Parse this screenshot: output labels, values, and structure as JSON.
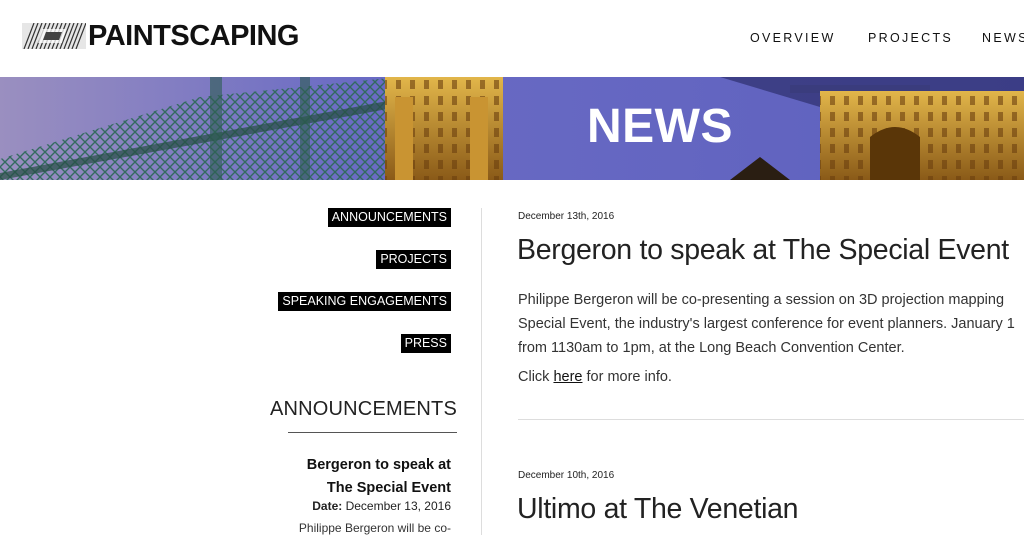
{
  "header": {
    "logo_text": "PAINTSCAPING",
    "nav": [
      "OVERVIEW",
      "PROJECTS",
      "NEWS"
    ]
  },
  "banner": {
    "title": "NEWS"
  },
  "sidebar": {
    "categories": [
      "ANNOUNCEMENTS",
      "PROJECTS",
      "SPEAKING ENGAGEMENTS",
      "PRESS"
    ],
    "section_heading": "ANNOUNCEMENTS",
    "recent_post": {
      "title_line1": "Bergeron to speak at",
      "title_line2": "The Special Event",
      "date_label": "Date:",
      "date_value": "December 13, 2016",
      "excerpt": "Philippe Bergeron will be co-"
    }
  },
  "posts": [
    {
      "date": "December 13th, 2016",
      "title": "Bergeron to speak at The Special Event",
      "body_lines": [
        "Philippe Bergeron will be co-presenting a session on 3D projection mapping",
        "Special Event, the industry's largest conference for event planners. January 1",
        "from 1130am to 1pm, at the Long Beach Convention Center."
      ],
      "more_prefix": "Click ",
      "more_link": "here",
      "more_suffix": " for more info."
    },
    {
      "date": "December 10th, 2016",
      "title": "Ultimo at The Venetian"
    }
  ],
  "colors": {
    "banner_sky": "#5f63bd",
    "tag_bg": "#000000",
    "tag_text": "#ffffff"
  }
}
